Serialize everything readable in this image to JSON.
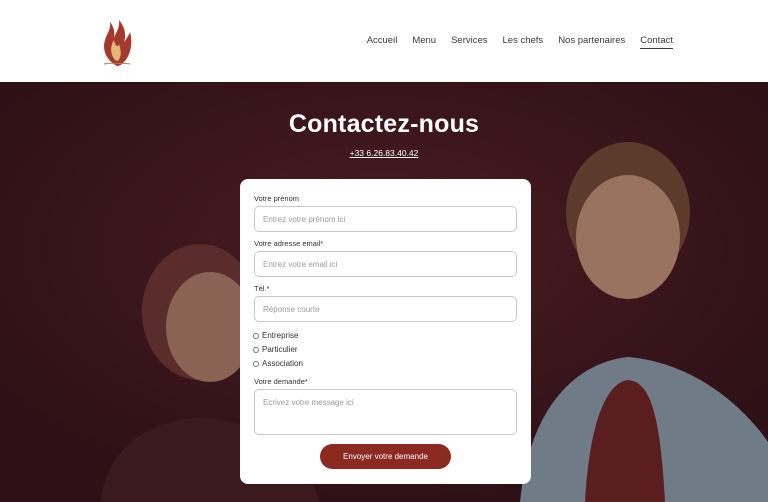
{
  "nav": {
    "items": [
      {
        "label": "Accueil"
      },
      {
        "label": "Menu"
      },
      {
        "label": "Services"
      },
      {
        "label": "Les chefs"
      },
      {
        "label": "Nos partenaires"
      },
      {
        "label": "Contact"
      }
    ],
    "active": "Contact"
  },
  "hero": {
    "title": "Contactez-nous",
    "phone": "+33 6.26.83.40.42"
  },
  "form": {
    "first_name": {
      "label": "Votre prénom",
      "placeholder": "Entrez votre prénom ici"
    },
    "email": {
      "label": "Votre adresse email*",
      "placeholder": "Entrez votre email ici"
    },
    "phone": {
      "label": "Tél.*",
      "placeholder": "Réponse courte"
    },
    "options": [
      "Entreprise",
      "Particulier",
      "Association"
    ],
    "request": {
      "label": "Votre demande*",
      "placeholder": "Ecrivez votre message ici"
    },
    "submit_label": "Envoyer votre demande"
  },
  "colors": {
    "hero_background": "#3a161c",
    "button": "#8c2a22",
    "logo_flame": "#a33a2b"
  },
  "icons": {
    "logo": "flame-hands-logo"
  }
}
